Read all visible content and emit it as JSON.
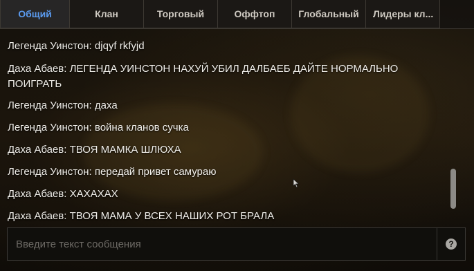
{
  "tabs": [
    {
      "label": "Общий",
      "active": true
    },
    {
      "label": "Клан",
      "active": false
    },
    {
      "label": "Торговый",
      "active": false
    },
    {
      "label": "Оффтоп",
      "active": false
    },
    {
      "label": "Глобальный",
      "active": false
    },
    {
      "label": "Лидеры кл...",
      "active": false
    }
  ],
  "messages": [
    {
      "text": "Легенда Уинстон: djqyf rkfyjd"
    },
    {
      "text": "Даха Абаев: ЛЕГЕНДА УИНСТОН НАХУЙ УБИЛ ДАЛБАЕБ ДАЙТЕ НОРМАЛЬНО ПОИГРАТЬ"
    },
    {
      "text": "Легенда Уинстон: даха"
    },
    {
      "text": "Легенда Уинстон: война кланов сучка"
    },
    {
      "text": "Даха Абаев: ТВОЯ МАМКА ШЛЮХА"
    },
    {
      "text": "Легенда Уинстон: передай привет самураю"
    },
    {
      "text": "Даха Абаев: ХАХАХАХ"
    },
    {
      "text": "Даха Абаев: ТВОЯ МАМА У ВСЕХ НАШИХ РОТ БРАЛА"
    }
  ],
  "input": {
    "value": "",
    "placeholder": "Введите текст сообщения"
  },
  "help_icon": "question-mark-icon",
  "colors": {
    "active_tab": "#5b9bf0",
    "message_text": "#f1efea",
    "scrollbar_thumb": "#8c8a86"
  }
}
